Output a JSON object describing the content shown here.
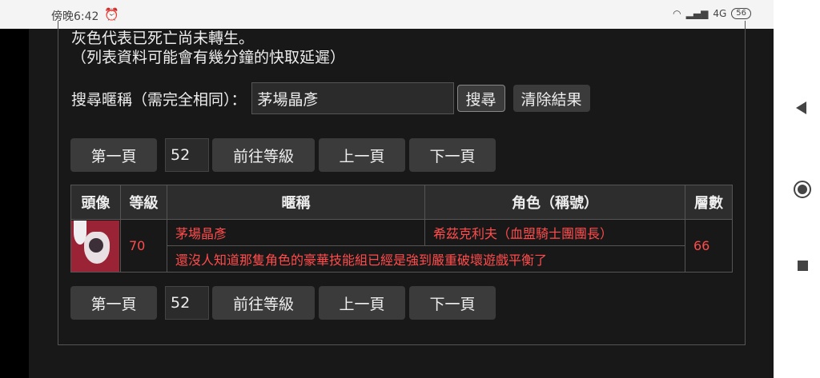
{
  "status_bar": {
    "time": "傍晚6:42",
    "network": "4G",
    "battery": "56"
  },
  "info": {
    "line1": "灰色代表已死亡尚未轉生。",
    "line2": "（列表資料可能會有幾分鐘的快取延遲）"
  },
  "search": {
    "label": "搜尋暱稱（需完全相同）：",
    "value": "茅場晶彥",
    "search_button": "搜尋",
    "clear_button": "清除結果"
  },
  "pager": {
    "first": "第一頁",
    "level_value": "52",
    "goto_level": "前往等級",
    "prev": "上一頁",
    "next": "下一頁"
  },
  "table": {
    "headers": [
      "頭像",
      "等級",
      "暱稱",
      "角色（稱號）",
      "層數"
    ],
    "row": {
      "level": "70",
      "nickname": "茅場晶彥",
      "role": "希茲克利夫（血盟騎士團團長）",
      "floor": "66",
      "quote": "還沒人知道那隻角色的豪華技能組已經是強到嚴重破壞遊戲平衡了"
    }
  },
  "colors": {
    "background": "#181818",
    "button": "#3b3b3b",
    "highlight_text": "#ff4c4c"
  }
}
